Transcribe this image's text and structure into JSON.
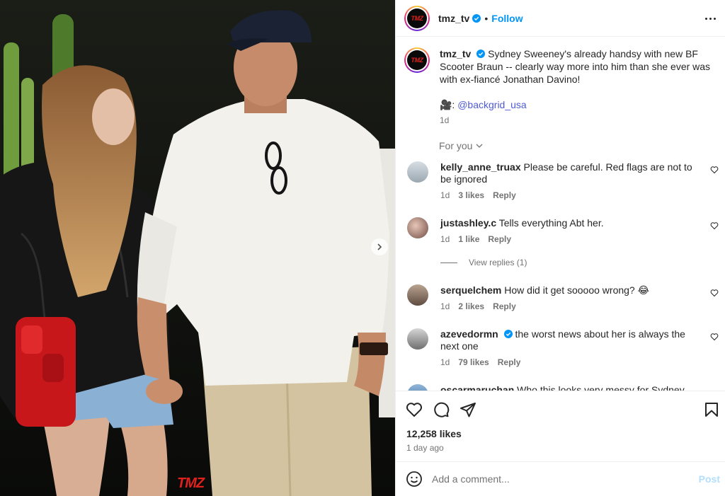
{
  "post": {
    "account": {
      "username": "tmz_tv",
      "avatar_text": "TMZ",
      "verified": true,
      "follow_label": "Follow",
      "more_icon": "more-horizontal-icon"
    },
    "media": {
      "watermark": "TMZ",
      "next_icon": "chevron-right-icon",
      "description_colors": {
        "background": "#0e0f0d",
        "shirt": "#f2f1ec",
        "pants": "#d4c3a0",
        "jacket": "#161616",
        "bag": "#c8171b"
      }
    },
    "caption": {
      "username": "tmz_tv",
      "text": "Sydney Sweeney's already handsy with new BF Scooter Braun -- clearly way more into him than she ever was with ex-fiancé Jonathan Davino!",
      "credit_prefix": "🎥: ",
      "credit_link": "@backgrid_usa",
      "time": "1d"
    },
    "for_you_label": "For you",
    "comments": [
      {
        "username": "kelly_anne_truax",
        "verified": false,
        "text": "Please be careful. Red flags are not to be ignored",
        "time": "1d",
        "likes": "3 likes",
        "reply": "Reply"
      },
      {
        "username": "justashley.c",
        "verified": false,
        "text": "Tells everything Abt her.",
        "time": "1d",
        "likes": "1 like",
        "reply": "Reply"
      },
      {
        "username": "serquelchem",
        "verified": false,
        "text": "How did it get sooooo wrong? 😂",
        "time": "1d",
        "likes": "2 likes",
        "reply": "Reply"
      },
      {
        "username": "azevedormn",
        "verified": true,
        "text": "the worst news about her is always the next one",
        "time": "1d",
        "likes": "79 likes",
        "reply": "Reply"
      },
      {
        "username": "oscarmaruchan",
        "verified": false,
        "text": "Who this looks very messy for Sydney smh",
        "time": "",
        "likes": "",
        "reply": ""
      }
    ],
    "view_replies": "View replies (1)",
    "likes_count": "12,258 likes",
    "posted_ago": "1 day ago",
    "add_comment_placeholder": "Add a comment...",
    "post_label": "Post",
    "colors": {
      "accent": "#0095f6",
      "link": "#00376b",
      "muted": "#737373",
      "post_disabled": "#b2dffc"
    }
  }
}
